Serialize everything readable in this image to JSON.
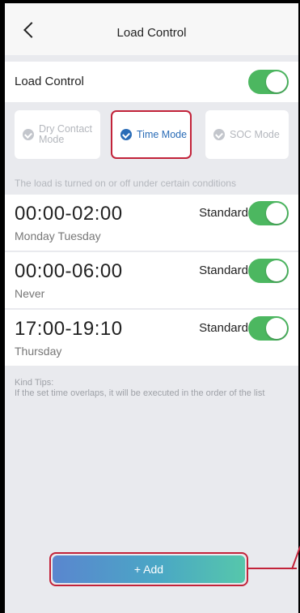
{
  "header": {
    "title": "Load Control"
  },
  "load_control": {
    "label": "Load Control",
    "enabled": true
  },
  "modes": [
    {
      "label": "Dry Contact Mode",
      "selected": false
    },
    {
      "label": "Time Mode",
      "selected": true
    },
    {
      "label": "SOC Mode",
      "selected": false
    }
  ],
  "description": "The load is turned on or off under certain conditions",
  "schedules": [
    {
      "time": "00:00-02:00",
      "days": "Monday Tuesday",
      "type": "Standard",
      "enabled": true
    },
    {
      "time": "00:00-06:00",
      "days": "Never",
      "type": "Standard",
      "enabled": true
    },
    {
      "time": "17:00-19:10",
      "days": "Thursday",
      "type": "Standard",
      "enabled": true
    }
  ],
  "tips": {
    "title": "Kind Tips:",
    "text": "If the set time overlaps, it will be executed in the order of the list"
  },
  "add_button": {
    "label": "+ Add"
  },
  "colors": {
    "toggle_on": "#4cb760",
    "accent": "#2a6cb7",
    "highlight": "#c2233a"
  },
  "icons": {
    "back": "chevron-left-icon",
    "check": "check-circle-icon"
  }
}
